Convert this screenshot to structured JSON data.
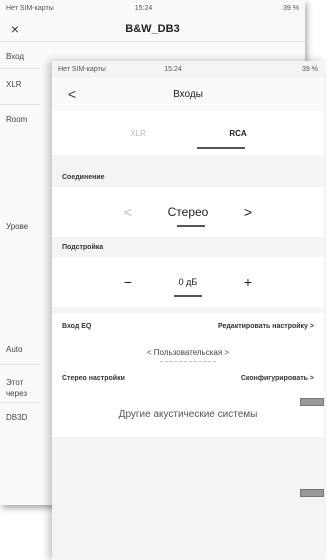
{
  "back_screen": {
    "status_bar": {
      "carrier": "Нет SIM-карты",
      "time": "15:24",
      "battery": "39 %"
    },
    "title": "B&W_DB3",
    "close_icon": "×",
    "items": [
      "Вход",
      "XLR",
      "Room",
      "Урове",
      "Auto",
      "Этот ",
      "через",
      "DB3D"
    ]
  },
  "front_screen": {
    "status_bar": {
      "carrier": "Нет SIM-карты",
      "time": "15:24",
      "battery": "39 %"
    },
    "title": "Входы",
    "back_icon": "<",
    "tabs": [
      "XLR",
      "RCA"
    ],
    "connection": {
      "label": "Соединение",
      "value": "Стерео",
      "prev": "<",
      "next": ">"
    },
    "trim": {
      "label": "Подстройка",
      "value": "0 дБ",
      "minus": "−",
      "plus": "+"
    },
    "input_eq": {
      "label": "Вход EQ",
      "action": "Редактировать настройку >"
    },
    "eq_preset": {
      "value": "< Пользовательская >"
    },
    "stereo": {
      "label": "Стерео настройки",
      "action": "Сконфигурировать >"
    },
    "other_speakers": "Другие акустические системы"
  }
}
